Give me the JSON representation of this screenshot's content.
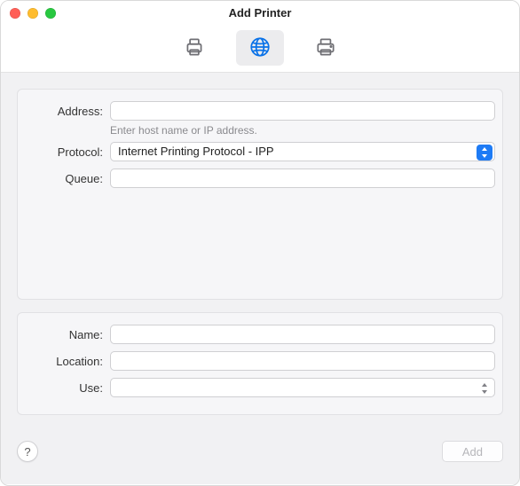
{
  "window": {
    "title": "Add Printer"
  },
  "toolbar": {
    "items": [
      {
        "name": "default-printer-tab",
        "icon": "printer-icon",
        "active": false
      },
      {
        "name": "ip-printer-tab",
        "icon": "globe-icon",
        "active": true
      },
      {
        "name": "windows-printer-tab",
        "icon": "printer-alt-icon",
        "active": false
      }
    ]
  },
  "form": {
    "address": {
      "label": "Address:",
      "value": "",
      "hint": "Enter host name or IP address."
    },
    "protocol": {
      "label": "Protocol:",
      "value": "Internet Printing Protocol - IPP"
    },
    "queue": {
      "label": "Queue:",
      "value": ""
    },
    "name": {
      "label": "Name:",
      "value": ""
    },
    "location": {
      "label": "Location:",
      "value": ""
    },
    "use": {
      "label": "Use:",
      "value": ""
    }
  },
  "footer": {
    "help_label": "?",
    "add_label": "Add"
  }
}
